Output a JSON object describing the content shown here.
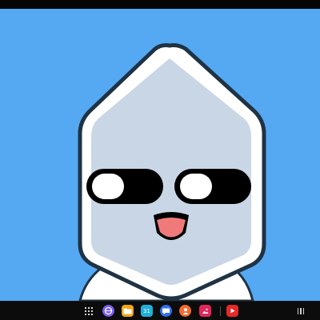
{
  "wallpaper": {
    "background_color": "#55a9f2",
    "character": {
      "head_fill": "#ffffff",
      "face_fill": "#c9d6e6",
      "outline_color": "#1f3344",
      "eye_white": "#ffffff",
      "pupil_color": "#000000",
      "mouth_color": "#000000",
      "tongue_color": "#f07a7a"
    }
  },
  "taskbar": {
    "background": "#0c0c0c",
    "apps": [
      {
        "name": "internet-browser-icon",
        "color": "#7a5cf0",
        "glyph": ""
      },
      {
        "name": "my-files-icon",
        "color": "#f2a516",
        "glyph": ""
      },
      {
        "name": "calendar-icon",
        "color": "#1fb0d8",
        "glyph": "31"
      },
      {
        "name": "messages-icon",
        "color": "#2f6ff0",
        "glyph": ""
      },
      {
        "name": "contacts-icon",
        "color": "#f26a2e",
        "glyph": ""
      },
      {
        "name": "gallery-icon",
        "color": "#e0265c",
        "glyph": ""
      },
      {
        "name": "youtube-icon",
        "color": "#e52a2a",
        "glyph": ""
      }
    ]
  }
}
